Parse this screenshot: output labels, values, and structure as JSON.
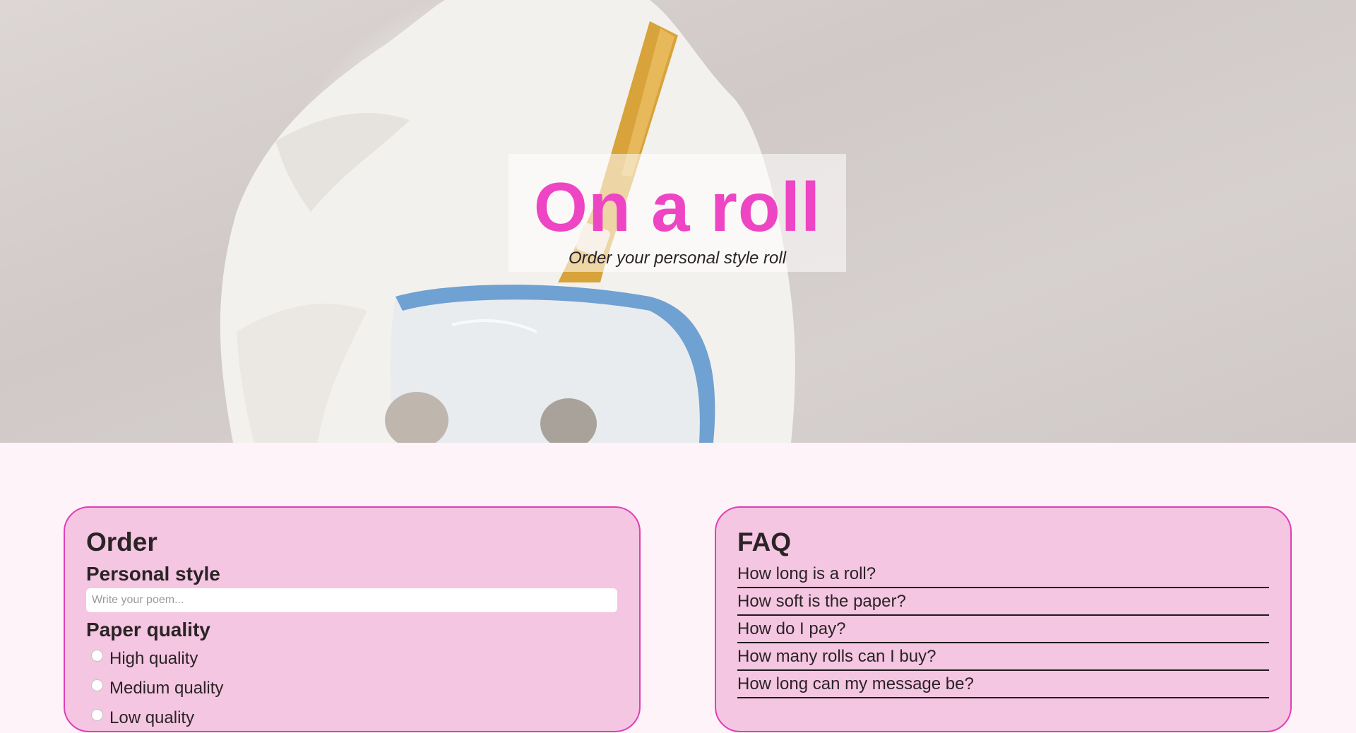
{
  "hero": {
    "title": "On a roll",
    "subtitle": "Order your personal style roll"
  },
  "order": {
    "heading": "Order",
    "personal_style_label": "Personal style",
    "poem_placeholder": "Write your poem...",
    "paper_quality_label": "Paper quality",
    "quality_options": [
      {
        "label": "High quality"
      },
      {
        "label": "Medium quality"
      },
      {
        "label": "Low quality"
      }
    ]
  },
  "faq": {
    "heading": "FAQ",
    "questions": [
      "How long is a roll?",
      "How soft is the paper?",
      "How do I pay?",
      "How many rolls can I buy?",
      "How long can my message be?"
    ]
  },
  "colors": {
    "accent": "#ee45c4",
    "card_background": "#f4c6e1",
    "card_border": "#e03fb7",
    "page_background": "#fef3f9"
  }
}
